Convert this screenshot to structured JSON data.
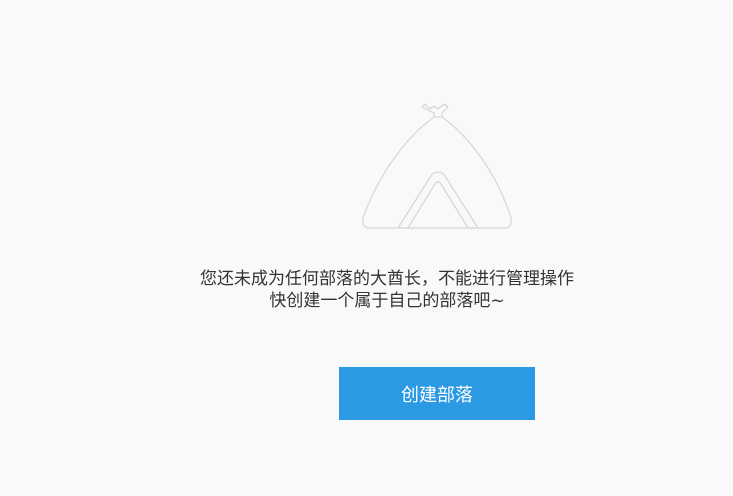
{
  "empty_state": {
    "illustration": "tent-icon",
    "message_line1": "您还未成为任何部落的大酋长，不能进行管理操作",
    "message_line2": "快创建一个属于自己的部落吧~",
    "create_button_label": "创建部落",
    "button_color": "#2b99e3",
    "icon_stroke_color": "#d8d8d8"
  }
}
